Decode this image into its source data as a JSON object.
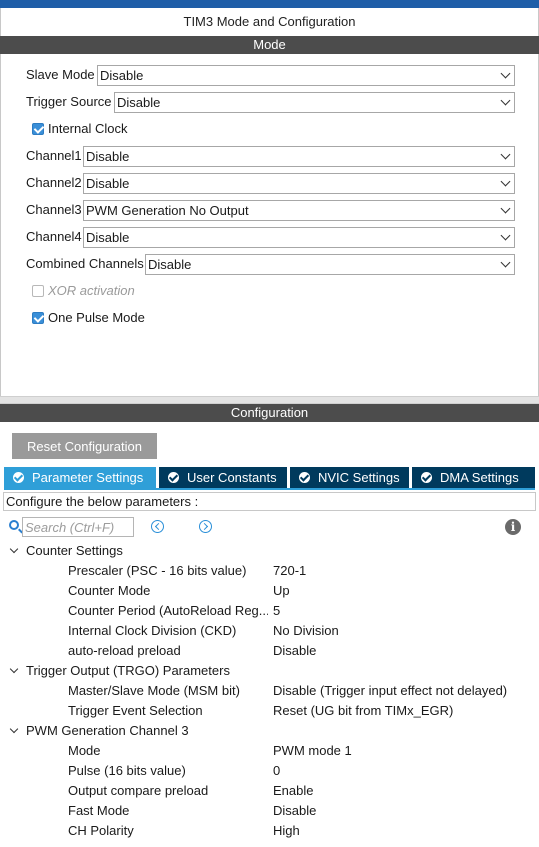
{
  "window": {
    "title": "TIM3 Mode and Configuration"
  },
  "mode": {
    "section_title": "Mode",
    "slave_mode": {
      "label": "Slave Mode",
      "value": "Disable"
    },
    "trigger_source": {
      "label": "Trigger Source",
      "value": "Disable"
    },
    "internal_clock": {
      "label": "Internal Clock",
      "checked": true
    },
    "channel1": {
      "label": "Channel1",
      "value": "Disable"
    },
    "channel2": {
      "label": "Channel2",
      "value": "Disable"
    },
    "channel3": {
      "label": "Channel3",
      "value": "PWM Generation No Output"
    },
    "channel4": {
      "label": "Channel4",
      "value": "Disable"
    },
    "combined_channels": {
      "label": "Combined Channels",
      "value": "Disable"
    },
    "xor_activation": {
      "label": "XOR activation",
      "checked": false,
      "disabled": true
    },
    "one_pulse_mode": {
      "label": "One Pulse Mode",
      "checked": true
    }
  },
  "configuration": {
    "section_title": "Configuration",
    "reset_button": "Reset Configuration",
    "tabs": [
      {
        "label": "Parameter Settings",
        "active": true
      },
      {
        "label": "User Constants",
        "active": false
      },
      {
        "label": "NVIC Settings",
        "active": false
      },
      {
        "label": "DMA Settings",
        "active": false
      }
    ],
    "params_header": "Configure the below parameters :",
    "search": {
      "placeholder": "Search (Ctrl+F)"
    },
    "groups": [
      {
        "title": "Counter Settings",
        "params": [
          {
            "name": "Prescaler (PSC - 16 bits value)",
            "value": "720-1"
          },
          {
            "name": "Counter Mode",
            "value": "Up"
          },
          {
            "name": "Counter Period (AutoReload Reg...",
            "value": "5"
          },
          {
            "name": "Internal Clock Division (CKD)",
            "value": "No Division"
          },
          {
            "name": "auto-reload preload",
            "value": "Disable"
          }
        ]
      },
      {
        "title": "Trigger Output (TRGO) Parameters",
        "params": [
          {
            "name": "Master/Slave Mode (MSM bit)",
            "value": "Disable (Trigger input effect not delayed)"
          },
          {
            "name": "Trigger Event Selection",
            "value": "Reset (UG bit from TIMx_EGR)"
          }
        ]
      },
      {
        "title": "PWM Generation Channel 3",
        "params": [
          {
            "name": "Mode",
            "value": "PWM mode 1"
          },
          {
            "name": "Pulse (16 bits value)",
            "value": "0"
          },
          {
            "name": "Output compare preload",
            "value": "Enable"
          },
          {
            "name": "Fast Mode",
            "value": "Disable"
          },
          {
            "name": "CH Polarity",
            "value": "High"
          }
        ]
      }
    ]
  },
  "colors": {
    "accent_blue": "#2f9fd8",
    "tab_dark": "#003a5d",
    "section_bar": "#4c4c4c",
    "top_bar": "#1f5ea8"
  },
  "icons": [
    "search-icon",
    "previous-icon",
    "next-icon",
    "info-icon",
    "check-icon",
    "chevron-down-icon",
    "caret-down-icon"
  ]
}
